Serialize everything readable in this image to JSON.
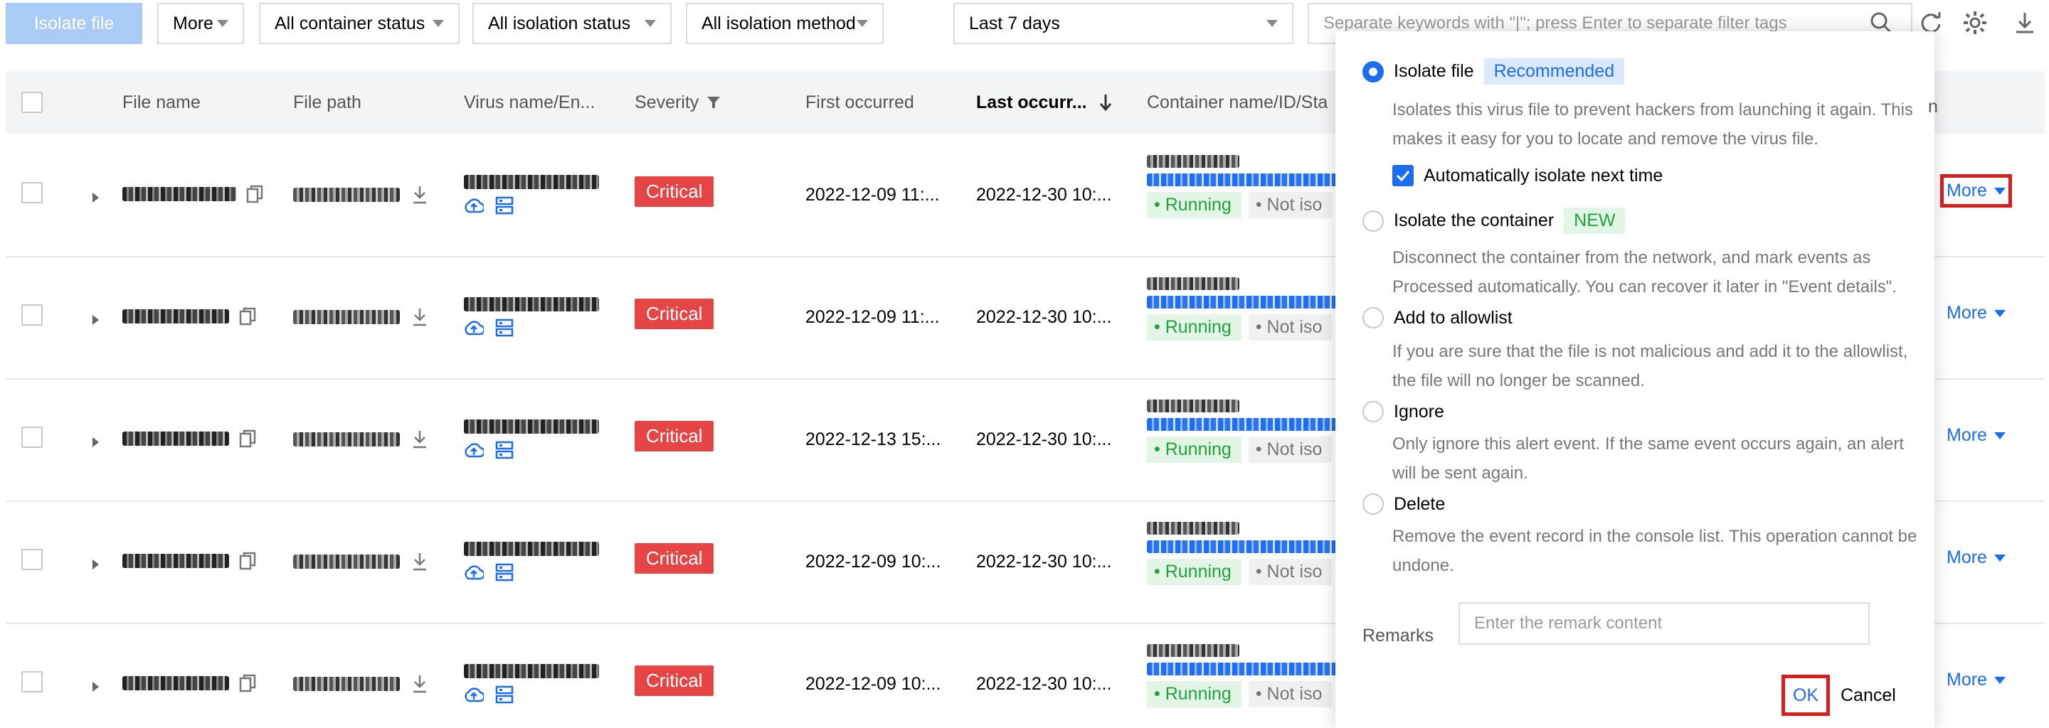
{
  "toolbar": {
    "isolate_file": "Isolate file",
    "more": "More",
    "container_status": "All container status",
    "isolation_status": "All isolation status",
    "isolation_method": "All isolation method",
    "time_range": "Last 7 days",
    "search_placeholder": "Separate keywords with \"|\"; press Enter to separate filter tags"
  },
  "columns": {
    "file_name": "File name",
    "file_path": "File path",
    "virus_name": "Virus name/En...",
    "severity": "Severity",
    "first_occurred": "First occurred",
    "last_occurred": "Last occurr...",
    "container": "Container name/ID/Sta"
  },
  "rows": [
    {
      "severity": "Critical",
      "first": "2022-12-09 11:...",
      "last": "2022-12-30 10:...",
      "running": "Running",
      "isolation": "Not iso",
      "more": "More"
    },
    {
      "severity": "Critical",
      "first": "2022-12-09 11:...",
      "last": "2022-12-30 10:...",
      "running": "Running",
      "isolation": "Not iso",
      "more": "More"
    },
    {
      "severity": "Critical",
      "first": "2022-12-13 15:...",
      "last": "2022-12-30 10:...",
      "running": "Running",
      "isolation": "Not iso",
      "more": "More"
    },
    {
      "severity": "Critical",
      "first": "2022-12-09 10:...",
      "last": "2022-12-30 10:...",
      "running": "Running",
      "isolation": "Not iso",
      "more": "More"
    },
    {
      "severity": "Critical",
      "first": "2022-12-09 10:...",
      "last": "2022-12-30 10:...",
      "running": "Running",
      "isolation": "Not iso",
      "more": "More"
    }
  ],
  "popover": {
    "options": [
      {
        "label": "Isolate file",
        "tag": "Recommended",
        "desc": "Isolates this virus file to prevent hackers from launching it again. This makes it easy for you to locate and remove the virus file.",
        "selected": true
      },
      {
        "label": "Isolate the container",
        "tag": "NEW",
        "desc": "Disconnect the container from the network, and mark events as Processed automatically. You can recover it later in \"Event details\".",
        "selected": false
      },
      {
        "label": "Add to allowlist",
        "desc": "If you are sure that the file is not malicious and add it to the allowlist, the file will no longer be scanned.",
        "selected": false
      },
      {
        "label": "Ignore",
        "desc": "Only ignore this alert event. If the same event occurs again, an alert will be sent again.",
        "selected": false
      },
      {
        "label": "Delete",
        "desc": "Remove the event record in the console list. This operation cannot be undone.",
        "selected": false
      }
    ],
    "auto_isolate": "Automatically isolate next time",
    "remarks_label": "Remarks",
    "remarks_placeholder": "Enter the remark content",
    "ok": "OK",
    "cancel": "Cancel",
    "header_fragment": "n"
  },
  "colors": {
    "primary": "#1a6cf0",
    "critical": "#e54545",
    "running_bg": "#e3f6e6",
    "running_fg": "#1fa33a",
    "highlight": "#d81e1e"
  }
}
